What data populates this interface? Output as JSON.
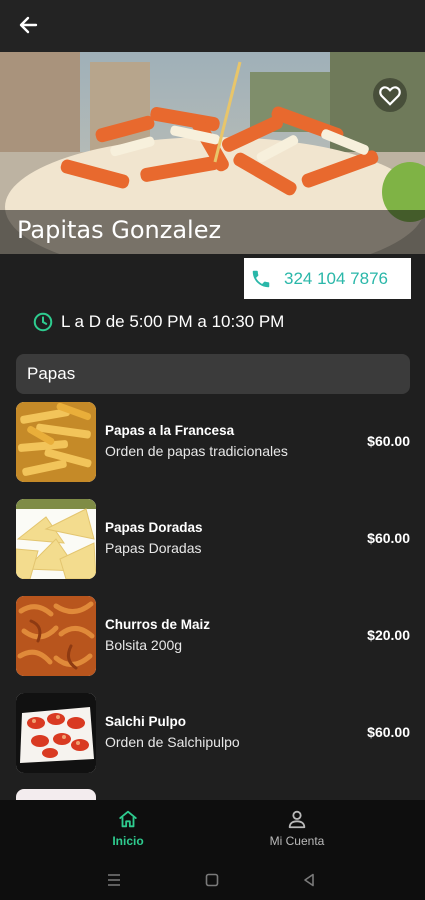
{
  "header": {
    "back_icon": "arrow-left-icon"
  },
  "restaurant": {
    "name": "Papitas Gonzalez",
    "favorite_icon": "heart-outline-icon",
    "phone": "324 104 7876",
    "phone_icon": "phone-icon",
    "hours": "L a D de 5:00 PM a 10:30 PM",
    "hours_icon": "clock-icon"
  },
  "menu": {
    "section_title": "Papas",
    "items": [
      {
        "name": "Papas a la Francesa",
        "description": "Orden de papas tradicionales",
        "price": "$60.00"
      },
      {
        "name": "Papas Doradas",
        "description": "Papas Doradas",
        "price": "$60.00"
      },
      {
        "name": "Churros de Maiz",
        "description": "Bolsita 200g",
        "price": "$20.00"
      },
      {
        "name": "Salchi Pulpo",
        "description": "Orden de Salchipulpo",
        "price": "$60.00"
      }
    ]
  },
  "bottom_nav": {
    "items": [
      {
        "label": "Inicio",
        "icon": "home-icon",
        "active": true
      },
      {
        "label": "Mi Cuenta",
        "icon": "person-icon",
        "active": false
      }
    ]
  },
  "colors": {
    "background": "#1f1f1f",
    "accent": "#2ecc8f",
    "phone_text": "#2ab7a9",
    "section_bg": "#3b3b3b"
  }
}
